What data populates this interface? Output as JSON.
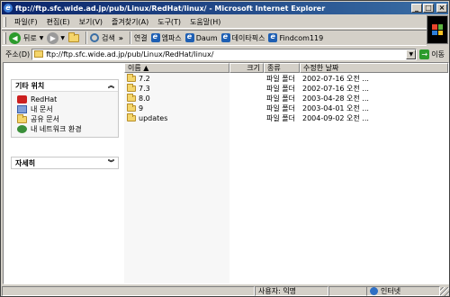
{
  "window": {
    "title": "ftp://ftp.sfc.wide.ad.jp/pub/Linux/RedHat/linux/ - Microsoft Internet Explorer",
    "min": "_",
    "max": "□",
    "close": "×"
  },
  "menu": [
    "파일(F)",
    "편집(E)",
    "보기(V)",
    "즐겨찾기(A)",
    "도구(T)",
    "도움말(H)"
  ],
  "toolbar": {
    "back_label": "뒤로",
    "search_label": "검색",
    "more": "»",
    "links_label": "연결",
    "links": [
      "엠파스",
      "Daum",
      "데이타픽스",
      "Findcom119"
    ]
  },
  "address": {
    "label": "주소(D)",
    "value": "ftp://ftp.sfc.wide.ad.jp/pub/Linux/RedHat/linux/",
    "go_label": "이동"
  },
  "tasks": {
    "other_places_title": "기타 위치",
    "other_places": [
      "RedHat",
      "내 문서",
      "공유 문서",
      "내 네트워크 환경"
    ],
    "details_title": "자세히"
  },
  "list": {
    "columns": [
      "이름 ▲",
      "크기",
      "종류",
      "수정한 날짜"
    ],
    "rows": [
      {
        "name": "7.2",
        "size": "",
        "type": "파일 폴더",
        "modified": "2002-07-16 오전 ..."
      },
      {
        "name": "7.3",
        "size": "",
        "type": "파일 폴더",
        "modified": "2002-07-16 오전 ..."
      },
      {
        "name": "8.0",
        "size": "",
        "type": "파일 폴더",
        "modified": "2003-04-28 오전 ..."
      },
      {
        "name": "9",
        "size": "",
        "type": "파일 폴더",
        "modified": "2003-04-01 오전 ..."
      },
      {
        "name": "updates",
        "size": "",
        "type": "파일 폴더",
        "modified": "2004-09-02 오전 ..."
      }
    ]
  },
  "status": {
    "user": "사용자: 익명",
    "zone": "인터넷"
  },
  "colors": {
    "title_start": "#0a246a",
    "title_end": "#3a6ea5",
    "chrome": "#d4d0c8",
    "folder": "#f4d56b"
  }
}
